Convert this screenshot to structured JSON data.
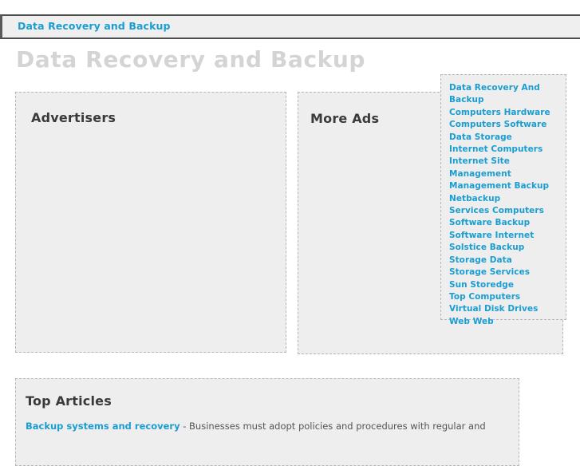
{
  "topbar": {
    "breadcrumb_label": "Data Recovery and Backup"
  },
  "page": {
    "title": "Data Recovery and Backup"
  },
  "advertisers": {
    "heading": "Advertisers"
  },
  "more_ads": {
    "heading": "More Ads"
  },
  "link_sidebar": {
    "links": [
      {
        "label": "Data Recovery And Backup"
      },
      {
        "label": "Computers Hardware"
      },
      {
        "label": "Computers Software"
      },
      {
        "label": "Data Storage"
      },
      {
        "label": "Internet Computers"
      },
      {
        "label": "Internet Site Management"
      },
      {
        "label": "Management Backup"
      },
      {
        "label": "Netbackup"
      },
      {
        "label": "Services Computers"
      },
      {
        "label": "Software Backup"
      },
      {
        "label": "Software Internet"
      },
      {
        "label": "Solstice Backup"
      },
      {
        "label": "Storage Data"
      },
      {
        "label": "Storage Services"
      },
      {
        "label": "Sun Storedge"
      },
      {
        "label": "Top Computers"
      },
      {
        "label": "Virtual Disk Drives"
      },
      {
        "label": "Web Web"
      }
    ]
  },
  "top_articles": {
    "heading": "Top Articles",
    "items": [
      {
        "link": "Backup systems and recovery",
        "separator": " - ",
        "text": "Businesses must adopt policies and procedures with regular and"
      }
    ]
  },
  "colors": {
    "link_blue": "#1a9dd0",
    "panel_bg": "#eeeeee",
    "panel_border": "#b6b6b6",
    "title_gray": "#d4d4d4",
    "topbar_bg": "#efefef"
  }
}
